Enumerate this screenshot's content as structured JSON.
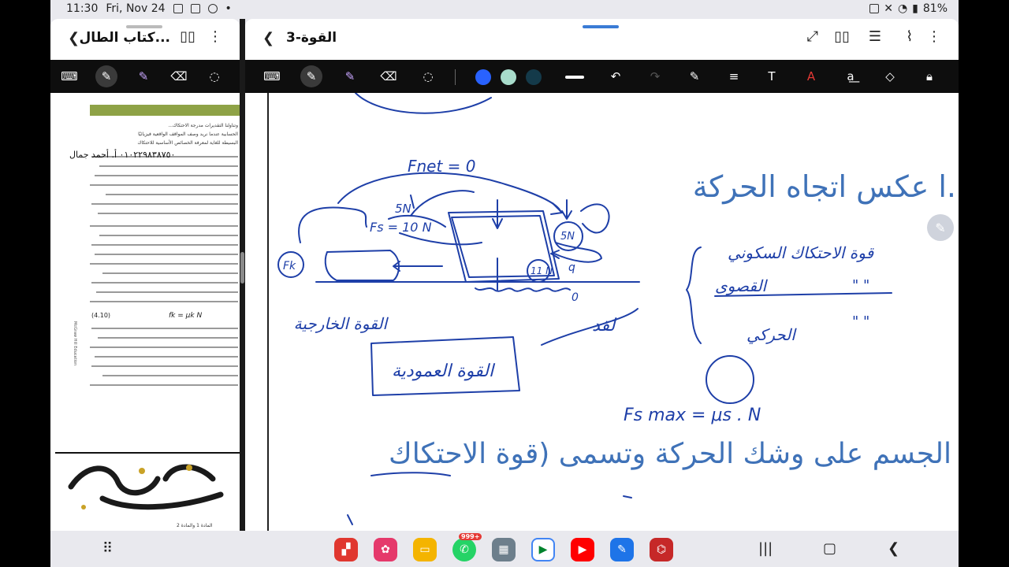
{
  "status_bar": {
    "time": "11:30",
    "date": "Fri, Nov 24",
    "battery": "81%"
  },
  "left_pane": {
    "title": "كتاب الطال...",
    "doc_text_lines": [
      "وتناولنا التقديرات مدرجة الاحتكاك...",
      "الحسابية عندما نريد وصف المواقف الواقعية فيزيائيًا",
      "البسيطة للغاية لمعرفة الخصائص الأساسية للاحتكاك",
      "(4.10)",
      "fk = μk N",
      "معامل الاحتكاك الحركي",
      "الاحتكاك الحركي في الجدول 4.1"
    ],
    "watermark_text": "٠١٠٢٢٩٨٣٨٧٥٠ أ. أحمد جمال",
    "page_footer": "المادة 1 والمادة 2"
  },
  "right_pane": {
    "title": "القوة-3",
    "pen_colors": [
      "#2962ff",
      "#a8dccb",
      "#143a4a"
    ],
    "typed_text_top": "ا عكس اتجاه الحركة.",
    "typed_text_bottom": "الجسم على وشك الحركة وتسمى (قوة الاحتكاك",
    "handwriting": {
      "fnet": "Fnet = 0",
      "fs": "Fs = 10 N",
      "label_5n_top": "5N",
      "label_5n_circle": "5N",
      "label_11n": "11 N",
      "label_fk": "Fk",
      "external_force": "القوة الخارجية",
      "normal_force": "القوة العمودية",
      "static_friction": "قوة الاحتكاك السكوني",
      "max_friction": "القصوى",
      "kinetic": "الحركي",
      "quote_marks_1": "\"  \"",
      "quote_marks_2": "\"  \"",
      "formula": "Fs max = μs . N",
      "zero_label": "0",
      "q_label": "q"
    }
  },
  "navbar": {
    "apps": [
      "flipboard",
      "blossom",
      "files",
      "whatsapp",
      "gallery",
      "meet",
      "youtube",
      "pen",
      "acrobat"
    ],
    "whatsapp_badge": "999+"
  }
}
